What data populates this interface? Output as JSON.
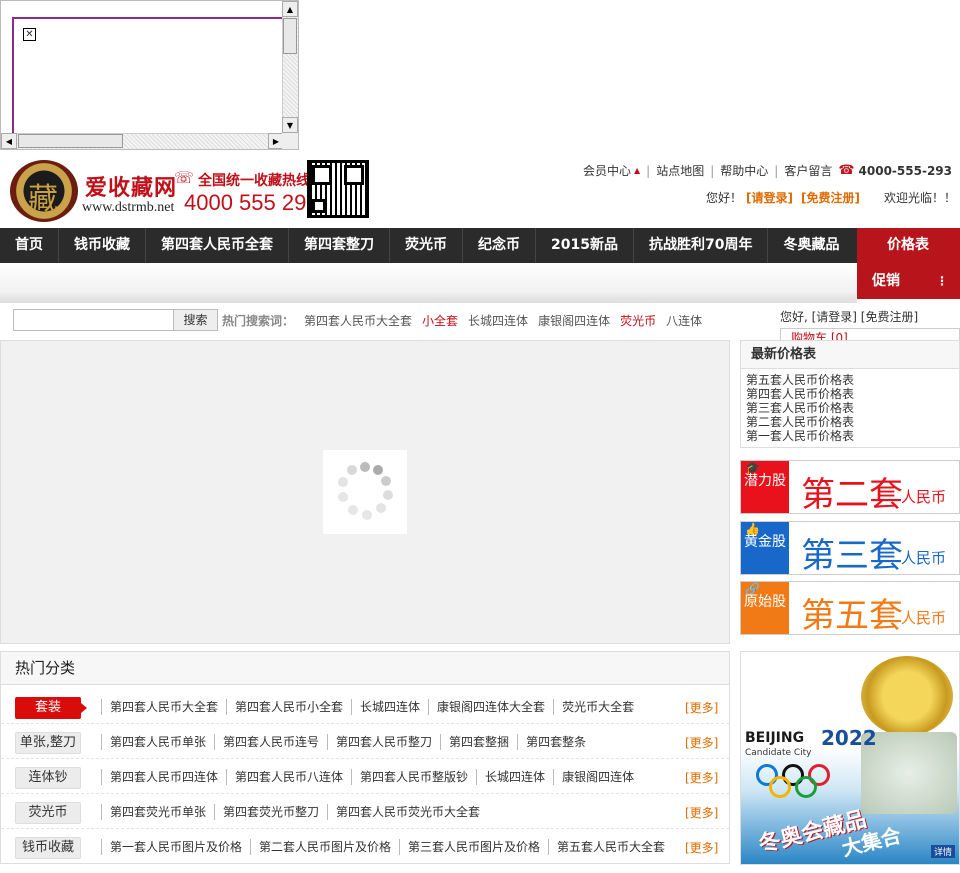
{
  "header": {
    "site_name": "爱收藏网",
    "site_url": "www.dstrmb.net",
    "logo_char": "藏",
    "hotline_label": "全国统一收藏热线",
    "hotline_number": "4000 555 293",
    "top_links": {
      "member_center": "会员中心",
      "site_map": "站点地图",
      "help_center": "帮助中心",
      "message": "客户留言",
      "phone": "4000-555-293"
    },
    "greeting": {
      "hello": "您好！",
      "login": "[请登录]",
      "register": "[免费注册]",
      "welcome": "欢迎光临！！"
    }
  },
  "nav": {
    "items": [
      "首页",
      "钱币收藏",
      "第四套人民币全套",
      "第四套整刀",
      "荧光币",
      "纪念币",
      "2015新品",
      "抗战胜利70周年",
      "冬奥藏品"
    ],
    "price_table": "价格表",
    "promotion": "促销",
    "promotion_more": "⋮"
  },
  "search": {
    "button": "搜索",
    "hot_label": "热门搜索词：",
    "keywords": [
      {
        "text": "第四套人民币大全套",
        "highlight": false
      },
      {
        "text": "小全套",
        "highlight": true
      },
      {
        "text": "长城四连体",
        "highlight": false
      },
      {
        "text": "康银阁四连体",
        "highlight": false
      },
      {
        "text": "荧光币",
        "highlight": true
      },
      {
        "text": "八连体",
        "highlight": false
      }
    ]
  },
  "user_mini": {
    "text": "您好, [请登录]  [免费注册]",
    "cart": "购物车 [0]"
  },
  "latest_prices": {
    "title": "最新价格表",
    "items": [
      "第五套人民币价格表",
      "第四套人民币价格表",
      "第三套人民币价格表",
      "第二套人民币价格表",
      "第一套人民币价格表"
    ]
  },
  "set_cards": [
    {
      "tag": "潜力股",
      "big": "第二套",
      "small": "人民币",
      "tag_color": "#e8111c",
      "text_color": "#e8111c"
    },
    {
      "tag": "黄金股",
      "big": "第三套",
      "small": "人民币",
      "tag_color": "#1768c8",
      "text_color": "#1768c8"
    },
    {
      "tag": "原始股",
      "big": "第五套",
      "small": "人民币",
      "tag_color": "#f27a16",
      "text_color": "#f27a16"
    }
  ],
  "olympic_ad": {
    "city": "BEIJING",
    "year": "2022",
    "candidate": "Candidate City",
    "slogan1": "冬奥会藏品",
    "slogan2": "大集合",
    "more": "详情"
  },
  "hot_categories": {
    "title": "热门分类",
    "more_label": "[更多]",
    "rows": [
      {
        "name": "套装",
        "active": true,
        "links": [
          "第四套人民币大全套",
          "第四套人民币小全套",
          "长城四连体",
          "康银阁四连体大全套",
          "荧光币大全套"
        ]
      },
      {
        "name": "单张,整刀",
        "active": false,
        "links": [
          "第四套人民币单张",
          "第四套人民币连号",
          "第四套人民币整刀",
          "第四套整捆",
          "第四套整条"
        ]
      },
      {
        "name": "连体钞",
        "active": false,
        "links": [
          "第四套人民币四连体",
          "第四套人民币八连体",
          "第四套人民币整版钞",
          "长城四连体",
          "康银阁四连体"
        ]
      },
      {
        "name": "荧光币",
        "active": false,
        "links": [
          "第四套荧光币单张",
          "第四套荧光币整刀",
          "第四套人民币荧光币大全套"
        ]
      },
      {
        "name": "钱币收藏",
        "active": false,
        "links": [
          "第一套人民币图片及价格",
          "第二套人民币图片及价格",
          "第三套人民币图片及价格",
          "第五套人民币大全套"
        ]
      }
    ]
  }
}
